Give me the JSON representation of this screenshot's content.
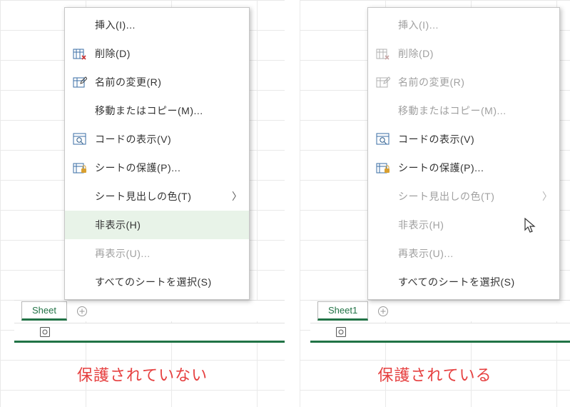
{
  "left": {
    "caption": "保護されていない",
    "sheet_tab": "Sheet",
    "menu": [
      {
        "icon": "",
        "label": "挿入(I)...",
        "disabled": false
      },
      {
        "icon": "delete",
        "label": "削除(D)",
        "disabled": false
      },
      {
        "icon": "rename",
        "label": "名前の変更(R)",
        "disabled": false
      },
      {
        "icon": "",
        "label": "移動またはコピー(M)...",
        "disabled": false
      },
      {
        "icon": "code",
        "label": "コードの表示(V)",
        "disabled": false
      },
      {
        "icon": "protect",
        "label": "シートの保護(P)...",
        "disabled": false
      },
      {
        "icon": "",
        "label": "シート見出しの色(T)",
        "disabled": false,
        "submenu": true
      },
      {
        "icon": "",
        "label": "非表示(H)",
        "disabled": false,
        "hovered": true
      },
      {
        "icon": "",
        "label": "再表示(U)...",
        "disabled": true
      },
      {
        "icon": "",
        "label": "すべてのシートを選択(S)",
        "disabled": false
      }
    ]
  },
  "right": {
    "caption": "保護されている",
    "sheet_tab": "Sheet1",
    "menu": [
      {
        "icon": "",
        "label": "挿入(I)...",
        "disabled": true
      },
      {
        "icon": "delete",
        "label": "削除(D)",
        "disabled": true
      },
      {
        "icon": "rename",
        "label": "名前の変更(R)",
        "disabled": true
      },
      {
        "icon": "",
        "label": "移動またはコピー(M)...",
        "disabled": true
      },
      {
        "icon": "code",
        "label": "コードの表示(V)",
        "disabled": false
      },
      {
        "icon": "protect",
        "label": "シートの保護(P)...",
        "disabled": false
      },
      {
        "icon": "",
        "label": "シート見出しの色(T)",
        "disabled": true,
        "submenu": true
      },
      {
        "icon": "",
        "label": "非表示(H)",
        "disabled": true
      },
      {
        "icon": "",
        "label": "再表示(U)...",
        "disabled": true
      },
      {
        "icon": "",
        "label": "すべてのシートを選択(S)",
        "disabled": false
      }
    ]
  },
  "arrow_glyph": "〉",
  "icons": {
    "delete": "sheet-delete-icon",
    "rename": "sheet-rename-icon",
    "code": "view-code-icon",
    "protect": "protect-sheet-icon"
  }
}
